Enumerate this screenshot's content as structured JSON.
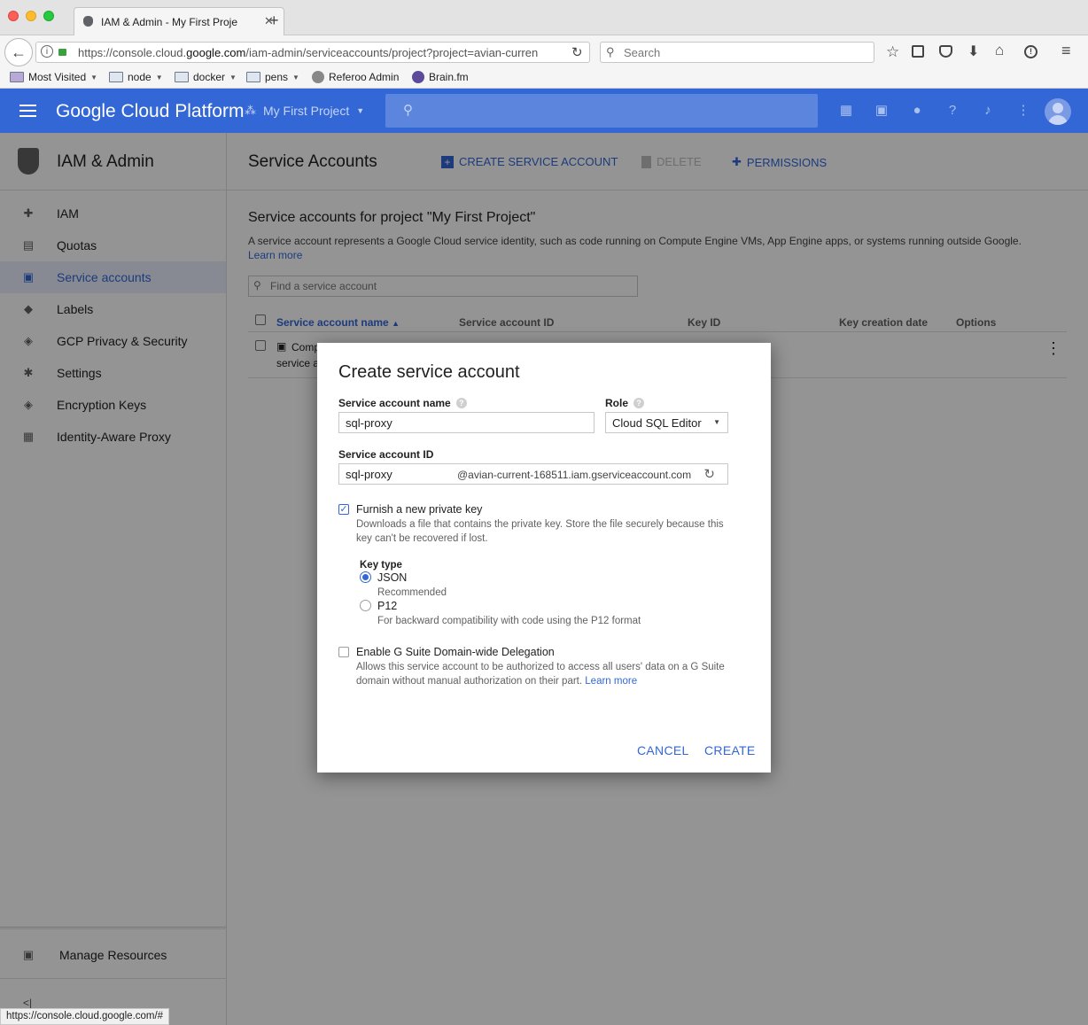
{
  "browser": {
    "tab_title": "IAM & Admin - My First Proje",
    "url": "https://console.cloud.google.com/iam-admin/serviceaccounts/project?project=avian-curren",
    "url_display_prefix": "https://console.cloud.",
    "url_display_domain": "google.com",
    "url_display_rest": "/iam-admin/serviceaccounts/project?project=avian-curren",
    "search_placeholder": "Search",
    "bookmarks": [
      {
        "label": "Most Visited",
        "dropdown": true
      },
      {
        "label": "node",
        "dropdown": true
      },
      {
        "label": "docker",
        "dropdown": true
      },
      {
        "label": "pens",
        "dropdown": true
      },
      {
        "label": "Referoo Admin",
        "dropdown": false
      },
      {
        "label": "Brain.fm",
        "dropdown": false
      }
    ],
    "status_url": "https://console.cloud.google.com/#"
  },
  "header": {
    "brand": "Google Cloud Platform",
    "project": "My First Project",
    "color": "#3367d6"
  },
  "sidebar": {
    "title": "IAM & Admin",
    "items": [
      {
        "label": "IAM",
        "icon": "add-person-icon"
      },
      {
        "label": "Quotas",
        "icon": "quota-icon"
      },
      {
        "label": "Service accounts",
        "icon": "service-account-icon",
        "active": true
      },
      {
        "label": "Labels",
        "icon": "label-icon"
      },
      {
        "label": "GCP Privacy & Security",
        "icon": "shield-icon"
      },
      {
        "label": "Settings",
        "icon": "gear-icon"
      },
      {
        "label": "Encryption Keys",
        "icon": "key-shield-icon"
      },
      {
        "label": "Identity-Aware Proxy",
        "icon": "proxy-icon"
      }
    ],
    "manage_resources": "Manage Resources"
  },
  "page": {
    "title": "Service Accounts",
    "actions": {
      "create": "CREATE SERVICE ACCOUNT",
      "delete": "DELETE",
      "permissions": "PERMISSIONS"
    },
    "section_title": "Service accounts for project \"My First Project\"",
    "description": "A service account represents a Google Cloud service identity, such as code running on Compute Engine VMs, App Engine apps, or systems running outside Google.",
    "learn_more": "Learn more",
    "filter_placeholder": "Find a service account",
    "table": {
      "columns": [
        "Service account name",
        "Service account ID",
        "Key ID",
        "Key creation date",
        "Options"
      ],
      "row_partial_line1": "Comp",
      "row_partial_line2": "service a"
    }
  },
  "dialog": {
    "title": "Create service account",
    "name_label": "Service account name",
    "name_value": "sql-proxy",
    "role_label": "Role",
    "role_value": "Cloud SQL Editor",
    "id_label": "Service account ID",
    "id_value": "sql-proxy",
    "id_suffix": "@avian-current-168511.iam.gserviceaccount.com",
    "furnish_label": "Furnish a new private key",
    "furnish_checked": true,
    "furnish_desc_1": "Downloads a file that contains the private key. Store the file securely because this",
    "furnish_desc_2": "key can't be recovered if lost.",
    "key_type_label": "Key type",
    "key_types": [
      {
        "label": "JSON",
        "desc": "Recommended",
        "selected": true
      },
      {
        "label": "P12",
        "desc": "For backward compatibility with code using the P12 format",
        "selected": false
      }
    ],
    "gsuite_label": "Enable G Suite Domain-wide Delegation",
    "gsuite_checked": false,
    "gsuite_desc_1": "Allows this service account to be authorized to access all users' data on a G Suite",
    "gsuite_desc_2": "domain without manual authorization on their part.",
    "gsuite_learn_more": "Learn more",
    "cancel": "CANCEL",
    "create": "CREATE",
    "accent": "#3367d6"
  }
}
